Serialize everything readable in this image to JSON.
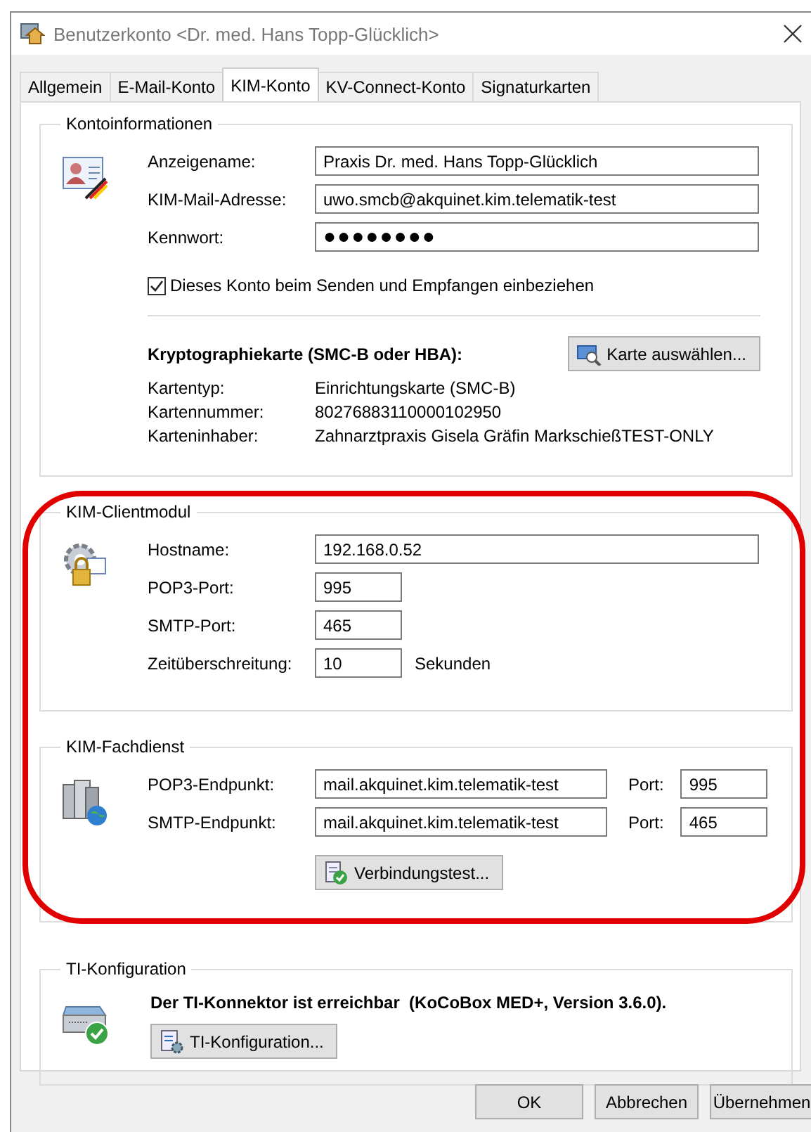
{
  "window": {
    "title": "Benutzerkonto <Dr. med. Hans Topp-Glücklich>"
  },
  "tabs": [
    {
      "label": "Allgemein",
      "selected": false
    },
    {
      "label": "E-Mail-Konto",
      "selected": false
    },
    {
      "label": "KIM-Konto",
      "selected": true
    },
    {
      "label": "KV-Connect-Konto",
      "selected": false
    },
    {
      "label": "Signaturkarten",
      "selected": false
    }
  ],
  "account_info": {
    "legend": "Kontoinformationen",
    "fields": [
      {
        "label": "Anzeigename:",
        "value": "Praxis Dr. med. Hans Topp-Glücklich",
        "kind": "text"
      },
      {
        "label": "KIM-Mail-Adresse:",
        "value": "uwo.smcb@akquinet.kim.telematik-test",
        "kind": "text"
      },
      {
        "label": "Kennwort:",
        "value": "●●●●●●●●",
        "kind": "password"
      }
    ],
    "include_checkbox": {
      "label": "Dieses Konto beim Senden und Empfangen einbeziehen",
      "checked": true
    },
    "card": {
      "heading": "Kryptographiekarte (SMC-B oder HBA):",
      "button": "Karte auswählen...",
      "rows": [
        {
          "label": "Kartentyp:",
          "value": "Einrichtungskarte (SMC-B)"
        },
        {
          "label": "Kartennummer:",
          "value": "80276883110000102950"
        },
        {
          "label": "Karteninhaber:",
          "value": "Zahnarztpraxis Gisela Gräfin MarkschießTEST-ONLY"
        }
      ]
    }
  },
  "client_module": {
    "legend": "KIM-Clientmodul",
    "fields": [
      {
        "label": "Hostname:",
        "value": "192.168.0.52",
        "kind": "wide"
      },
      {
        "label": "POP3-Port:",
        "value": "995",
        "kind": "short"
      },
      {
        "label": "SMTP-Port:",
        "value": "465",
        "kind": "short"
      },
      {
        "label": "Zeitüberschreitung:",
        "value": "10",
        "kind": "short",
        "unit": "Sekunden"
      }
    ]
  },
  "service": {
    "legend": "KIM-Fachdienst",
    "endpoints": [
      {
        "label": "POP3-Endpunkt:",
        "value": "mail.akquinet.kim.telematik-test",
        "port_label": "Port:",
        "port": "995"
      },
      {
        "label": "SMTP-Endpunkt:",
        "value": "mail.akquinet.kim.telematik-test",
        "port_label": "Port:",
        "port": "465"
      }
    ],
    "button": "Verbindungstest..."
  },
  "ti_config": {
    "legend": "TI-Konfiguration",
    "status": "Der TI-Konnektor ist erreichbar  (KoCoBox MED+, Version 3.6.0).",
    "button": "TI-Konfiguration..."
  },
  "buttons": [
    "OK",
    "Abbrechen",
    "Übernehmen"
  ]
}
